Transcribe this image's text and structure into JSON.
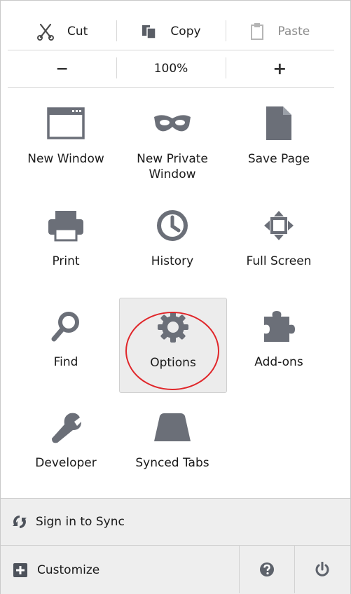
{
  "edit": {
    "cut_label": "Cut",
    "copy_label": "Copy",
    "paste_label": "Paste"
  },
  "zoom": {
    "minus_label": "−",
    "level_label": "100%",
    "plus_label": "+"
  },
  "tiles": [
    {
      "label": "New Window",
      "icon": "new-window-icon"
    },
    {
      "label": "New Private\nWindow",
      "icon": "private-mask-icon"
    },
    {
      "label": "Save Page",
      "icon": "save-page-icon"
    },
    {
      "label": "Print",
      "icon": "printer-icon"
    },
    {
      "label": "History",
      "icon": "clock-icon"
    },
    {
      "label": "Full Screen",
      "icon": "fullscreen-icon"
    },
    {
      "label": "Find",
      "icon": "magnifier-icon"
    },
    {
      "label": "Options",
      "icon": "gear-icon"
    },
    {
      "label": "Add-ons",
      "icon": "puzzle-icon"
    },
    {
      "label": "Developer",
      "icon": "wrench-icon"
    },
    {
      "label": "Synced Tabs",
      "icon": "synced-tabs-icon"
    }
  ],
  "footer": {
    "sync_label": "Sign in to Sync",
    "customize_label": "Customize"
  },
  "colors": {
    "icon_gray": "#6b6f78",
    "selected_bg": "#ececec",
    "highlight_circle": "#e0262a",
    "footer_bg": "#eeeeee"
  }
}
